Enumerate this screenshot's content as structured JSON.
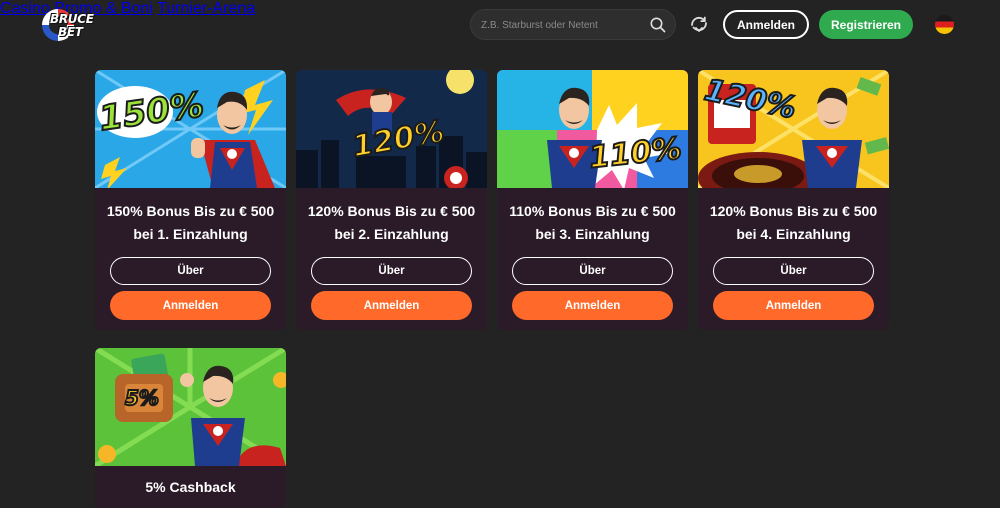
{
  "header": {
    "logo_text_1": "BRUCE",
    "logo_text_2": "BET",
    "nav": [
      "Casino",
      "Promo & Boni",
      "Turnier-Arena"
    ],
    "search_placeholder": "Z.B. Starburst oder Netent",
    "login_label": "Anmelden",
    "register_label": "Registrieren",
    "language_flag": "de-flag-icon"
  },
  "promos": [
    {
      "percent": "150%",
      "title": "150% Bonus Bis zu € 500 bei 1. Einzahlung",
      "about_label": "Über",
      "signup_label": "Anmelden"
    },
    {
      "percent": "120%",
      "title": "120% Bonus Bis zu € 500 bei 2. Einzahlung",
      "about_label": "Über",
      "signup_label": "Anmelden"
    },
    {
      "percent": "110%",
      "title": "110% Bonus Bis zu € 500 bei 3. Einzahlung",
      "about_label": "Über",
      "signup_label": "Anmelden"
    },
    {
      "percent": "120%",
      "title": "120% Bonus Bis zu € 500 bei 4. Einzahlung",
      "about_label": "Über",
      "signup_label": "Anmelden"
    },
    {
      "percent": "5%",
      "title": "5% Cashback"
    }
  ],
  "colors": {
    "background": "#232323",
    "card": "#2b1b28",
    "accent_orange": "#ff6a2a",
    "register_green": "#2faa4f"
  }
}
